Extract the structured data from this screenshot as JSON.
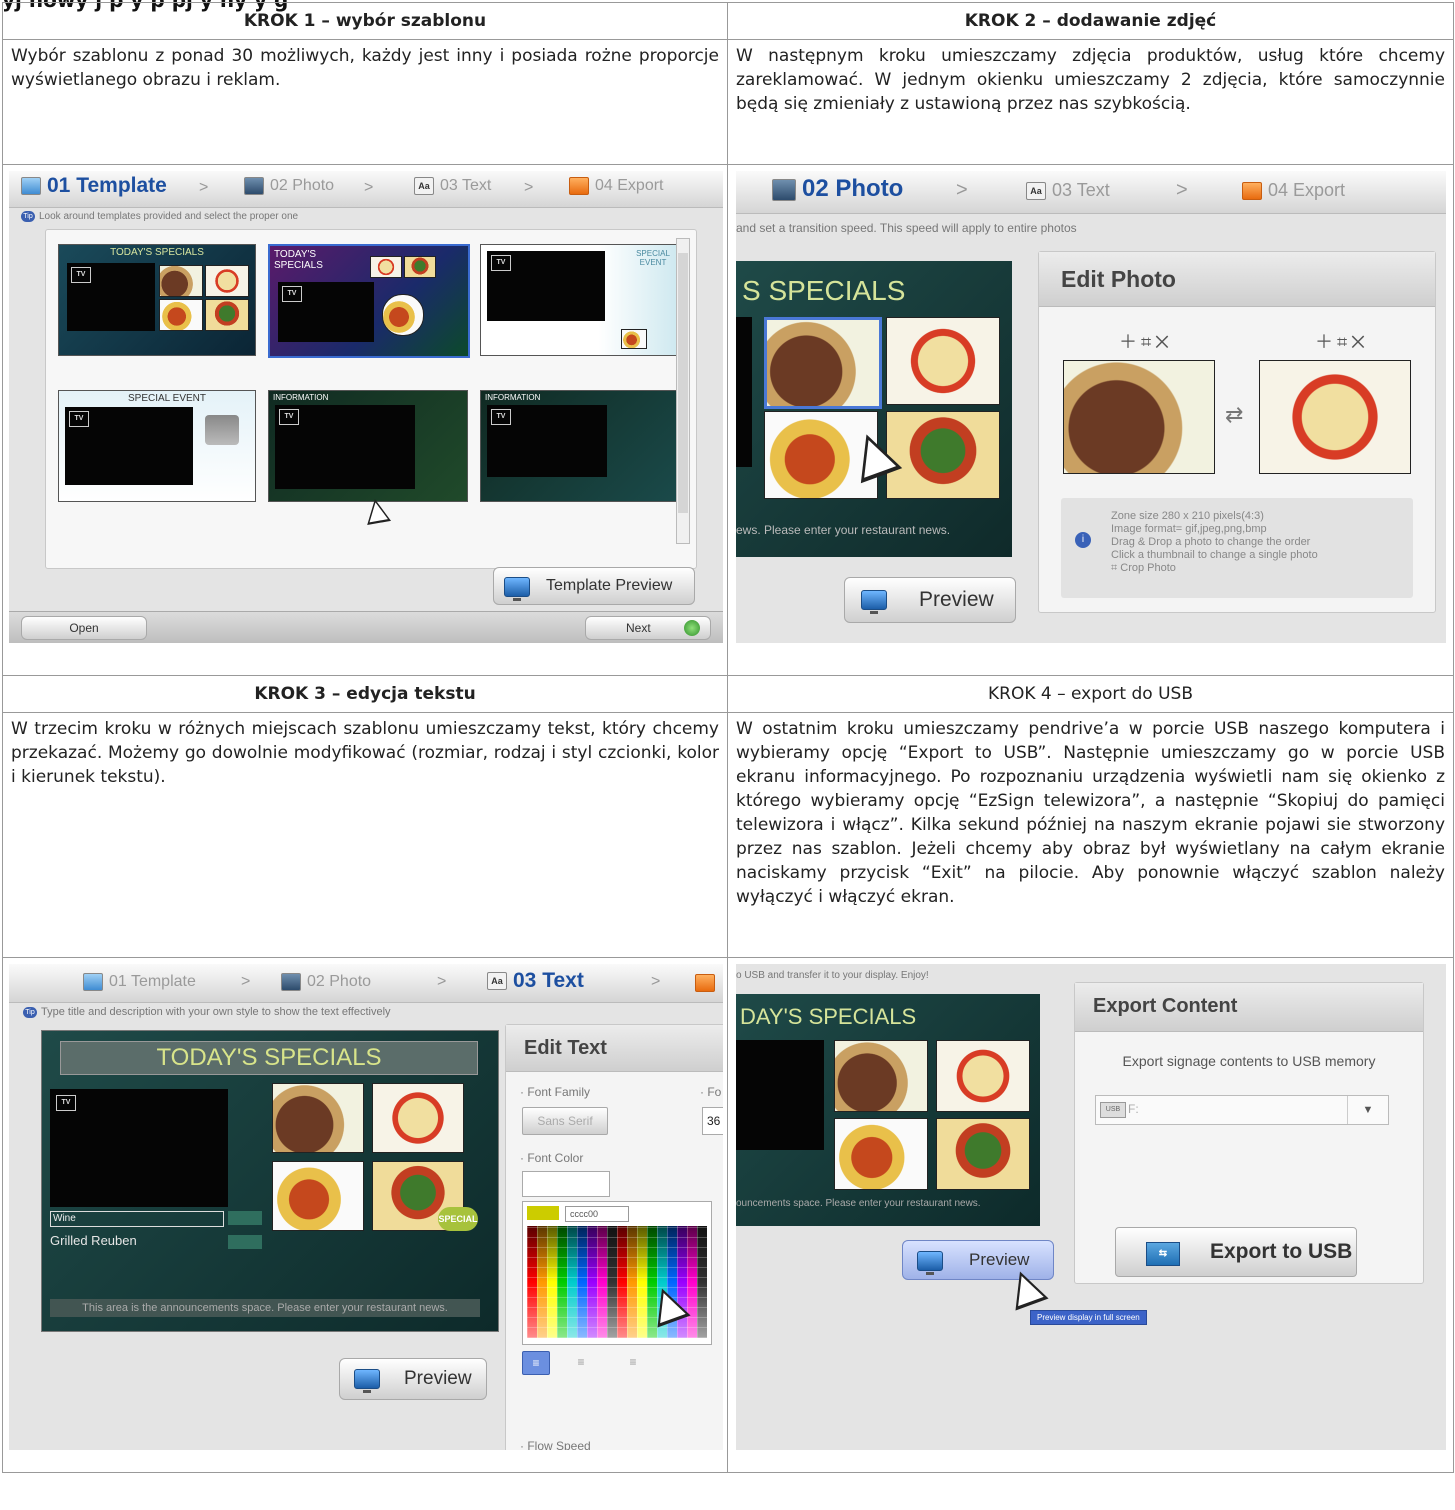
{
  "page": {
    "cut_heading": "yj  nowy    j    p      y p  pj y   ny    y  g"
  },
  "cells": {
    "step1": {
      "heading": "KROK 1 – wybór szablonu",
      "text": "Wybór szablonu z ponad 30 możliwych, każdy jest inny i posiada rożne proporcje wyświetlanego obrazu i  reklam."
    },
    "step2": {
      "heading": "KROK 2 – dodawanie zdjęć",
      "text": "W następnym kroku umieszczamy zdjęcia produktów, usług które chcemy zareklamować. W jednym okienku umieszczamy 2 zdjęcia, które samoczynnie będą się zmieniały z ustawioną przez nas szybkością."
    },
    "step3": {
      "heading": "KROK 3 – edycja tekstu",
      "text": "W trzecim kroku w różnych miejscach szablonu umieszczamy tekst, który chcemy przekazać. Możemy go dowolnie modyfikować (rozmiar, rodzaj i styl czcionki, kolor i kierunek tekstu)."
    },
    "step4": {
      "heading": "KROK 4 – export do USB",
      "text": "W ostatnim kroku umieszczamy pendrive’a w porcie USB naszego komputera i wybieramy opcję “Export to USB”. Następnie umieszczamy go w porcie USB ekranu informacyjnego. Po rozpoznaniu urządzenia wyświetli nam się okienko z którego wybieramy opcję “EzSign telewizora”, a następnie “Skopiuj do pamięci telewizora i włącz”. Kilka sekund później na naszym ekranie pojawi sie stworzony przez nas szablon. Jeżeli chcemy aby obraz był wyświetlany na całym ekranie naciskamy przycisk “Exit” na pilocie. Aby ponownie włączyć szablon należy wyłączyć i włączyć ekran."
    }
  },
  "steps": {
    "template": "01 Template",
    "photo": "02 Photo",
    "text": "03 Text",
    "export": "04 Export",
    "sep": ">",
    "text_icon": "Aa"
  },
  "shot1": {
    "hint": "Look around templates provided and select the proper one",
    "preview_button": "Template Preview",
    "open_button": "Open",
    "next_button": "Next",
    "templates": [
      "TODAY'S SPECIALS",
      "TODAY'S SPECIALS",
      "SPECIAL EVENT",
      "SPECIAL EVENT",
      "INFORMATION",
      "INFORMATION"
    ]
  },
  "shot2": {
    "hint": "and set a transition speed. This speed will apply to entire photos",
    "banner": "S SPECIALS",
    "panel_title": "Edit Photo",
    "info_lines": [
      "Zone size    280 x 210 pixels(4:3)",
      "Image format= gif,jpeg,png,bmp",
      "Drag & Drop a photo to change the order",
      "Click a thumbnail to change a single photo",
      "Crop Photo"
    ],
    "notice": "ews. Please enter your restaurant news.",
    "preview_button": "Preview"
  },
  "shot3": {
    "hint": "Type title and description with your own style to show the text effectively",
    "banner": "TODAY'S SPECIALS",
    "item1": "Wine",
    "item2": "Grilled Reuben",
    "notice": "This area is the announcements space. Please enter your restaurant news.",
    "special": "SPECIAL",
    "panel_title": "Edit Text",
    "font_family_label": "· Font Family",
    "font_size_label": "· Fo",
    "font_family_value": "Sans Serif",
    "font_size_value": "36",
    "font_color_label": "· Font Color",
    "color_hex": "cccc00",
    "flow_speed_label": "· Flow Speed",
    "preview_button": "Preview"
  },
  "shot4": {
    "hint": "o USB and transfer it to your display. Enjoy!",
    "banner": "DAY'S SPECIALS",
    "notice": "ouncements space. Please enter your restaurant news.",
    "panel_title": "Export Content",
    "export_desc": "Export signage contents to USB memory",
    "drive": "F:",
    "export_button": "Export to USB",
    "preview_button": "Preview",
    "tooltip": "Preview display in full screen"
  }
}
